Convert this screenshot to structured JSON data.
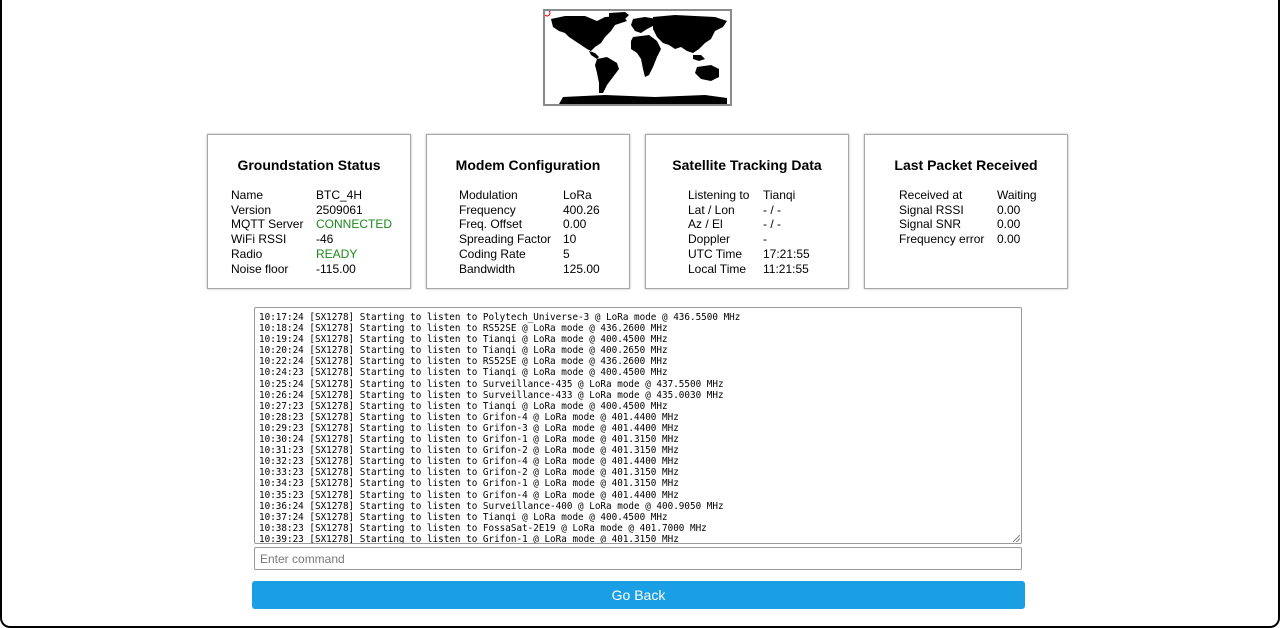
{
  "groundstation": {
    "title": "Groundstation Status",
    "rows": [
      {
        "label": "Name",
        "value": "BTC_4H"
      },
      {
        "label": "Version",
        "value": "2509061"
      },
      {
        "label": "MQTT Server",
        "value": "CONNECTED"
      },
      {
        "label": "WiFi RSSI",
        "value": "-46"
      },
      {
        "label": "Radio",
        "value": "READY"
      },
      {
        "label": "Noise floor",
        "value": "-115.00"
      }
    ]
  },
  "modem": {
    "title": "Modem Configuration",
    "rows": [
      {
        "label": "Modulation",
        "value": "LoRa"
      },
      {
        "label": "Frequency",
        "value": "400.26"
      },
      {
        "label": "Freq. Offset",
        "value": "0.00"
      },
      {
        "label": "Spreading Factor",
        "value": "10"
      },
      {
        "label": "Coding Rate",
        "value": "5"
      },
      {
        "label": "Bandwidth",
        "value": "125.00"
      }
    ]
  },
  "satellite": {
    "title": "Satellite Tracking Data",
    "rows": [
      {
        "label": "Listening to",
        "value": "Tianqi"
      },
      {
        "label": "Lat / Lon",
        "value": "- / -"
      },
      {
        "label": "Az / El",
        "value": "- / -"
      },
      {
        "label": "Doppler",
        "value": "-"
      },
      {
        "label": "UTC Time",
        "value": "17:21:55"
      },
      {
        "label": "Local Time",
        "value": "11:21:55"
      }
    ]
  },
  "packet": {
    "title": "Last Packet Received",
    "rows": [
      {
        "label": "Received at",
        "value": "Waiting"
      },
      {
        "label": "Signal RSSI",
        "value": "0.00"
      },
      {
        "label": "Signal SNR",
        "value": "0.00"
      },
      {
        "label": "Frequency error",
        "value": "0.00"
      }
    ]
  },
  "console": {
    "lines": [
      "10:17:24 [SX1278] Starting to listen to Polytech_Universe-3 @ LoRa mode @ 436.5500 MHz",
      "10:18:24 [SX1278] Starting to listen to RS52SE @ LoRa mode @ 436.2600 MHz",
      "10:19:24 [SX1278] Starting to listen to Tianqi @ LoRa mode @ 400.4500 MHz",
      "10:20:24 [SX1278] Starting to listen to Tianqi @ LoRa mode @ 400.2650 MHz",
      "10:22:24 [SX1278] Starting to listen to RS52SE @ LoRa mode @ 436.2600 MHz",
      "10:24:23 [SX1278] Starting to listen to Tianqi @ LoRa mode @ 400.4500 MHz",
      "10:25:24 [SX1278] Starting to listen to Surveillance-435 @ LoRa mode @ 437.5500 MHz",
      "10:26:24 [SX1278] Starting to listen to Surveillance-433 @ LoRa mode @ 435.0030 MHz",
      "10:27:23 [SX1278] Starting to listen to Tianqi @ LoRa mode @ 400.4500 MHz",
      "10:28:23 [SX1278] Starting to listen to Grifon-4 @ LoRa mode @ 401.4400 MHz",
      "10:29:23 [SX1278] Starting to listen to Grifon-3 @ LoRa mode @ 401.4400 MHz",
      "10:30:24 [SX1278] Starting to listen to Grifon-1 @ LoRa mode @ 401.3150 MHz",
      "10:31:23 [SX1278] Starting to listen to Grifon-2 @ LoRa mode @ 401.3150 MHz",
      "10:32:23 [SX1278] Starting to listen to Grifon-4 @ LoRa mode @ 401.4400 MHz",
      "10:33:23 [SX1278] Starting to listen to Grifon-2 @ LoRa mode @ 401.3150 MHz",
      "10:34:23 [SX1278] Starting to listen to Grifon-1 @ LoRa mode @ 401.3150 MHz",
      "10:35:23 [SX1278] Starting to listen to Grifon-4 @ LoRa mode @ 401.4400 MHz",
      "10:36:24 [SX1278] Starting to listen to Surveillance-400 @ LoRa mode @ 400.9050 MHz",
      "10:37:24 [SX1278] Starting to listen to Tianqi @ LoRa mode @ 400.4500 MHz",
      "10:38:23 [SX1278] Starting to listen to FossaSat-2E19 @ LoRa mode @ 401.7000 MHz",
      "10:39:23 [SX1278] Starting to listen to Grifon-1 @ LoRa mode @ 401.3150 MHz"
    ]
  },
  "command": {
    "placeholder": "Enter command",
    "value": ""
  },
  "back_button": {
    "label": "Go Back"
  },
  "colors": {
    "accent": "#1a9fe5",
    "ok": "#1a8a1a"
  }
}
